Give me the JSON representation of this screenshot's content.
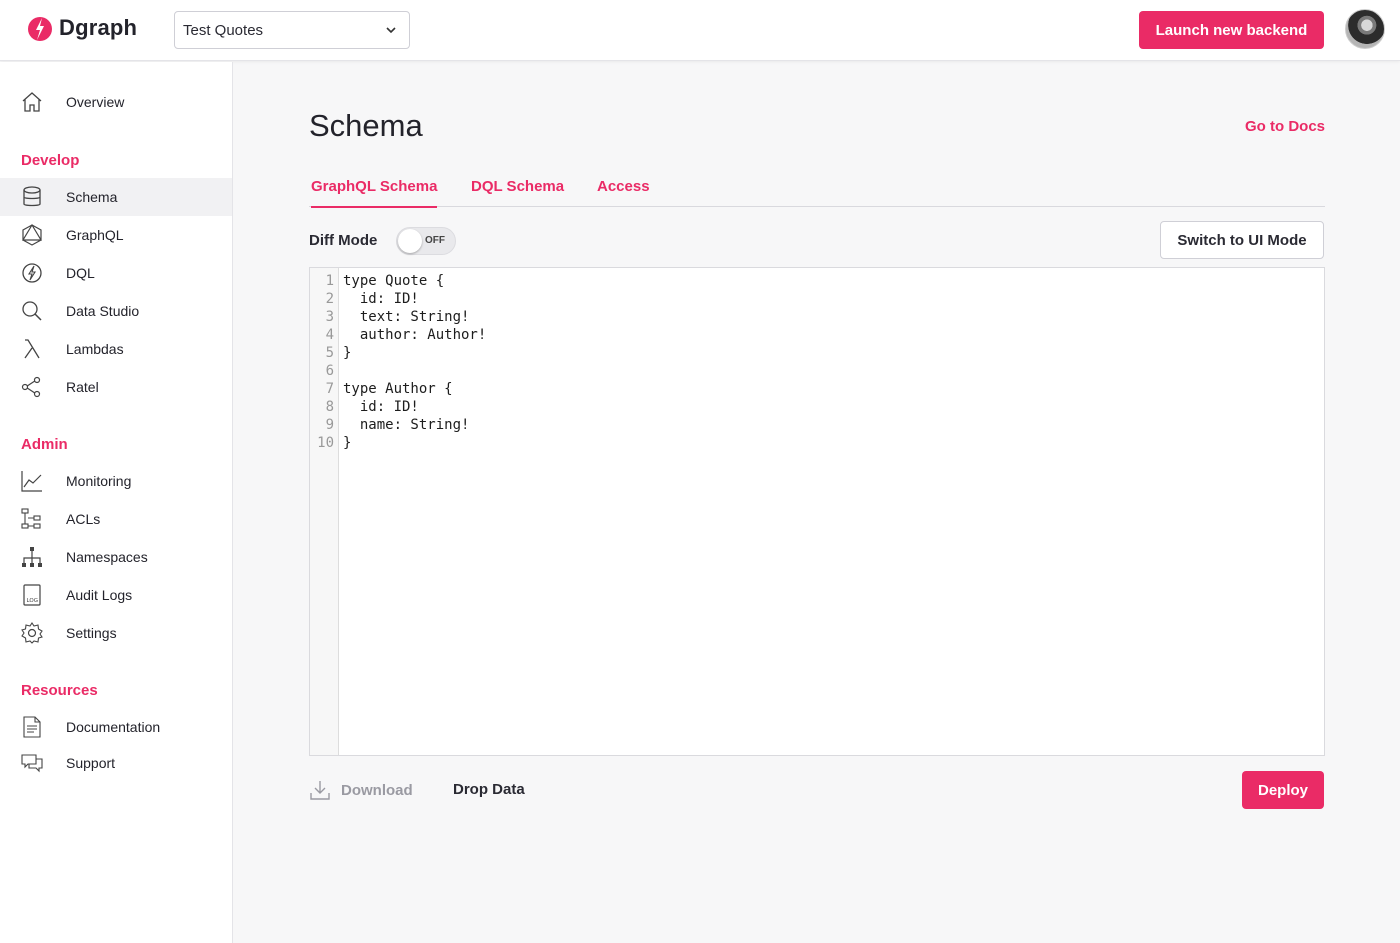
{
  "brand": {
    "name": "Dgraph",
    "accent": "#ea2b66"
  },
  "header": {
    "backend_selected": "Test Quotes",
    "launch_label": "Launch new backend",
    "avatar_icon": "user-avatar"
  },
  "sidebar": {
    "overview": "Overview",
    "sections": {
      "develop": "Develop",
      "admin": "Admin",
      "resources": "Resources"
    },
    "develop_items": [
      "Schema",
      "GraphQL",
      "DQL",
      "Data Studio",
      "Lambdas",
      "Ratel"
    ],
    "admin_items": [
      "Monitoring",
      "ACLs",
      "Namespaces",
      "Audit Logs",
      "Settings"
    ],
    "resource_items": [
      "Documentation",
      "Support"
    ],
    "active_item": "Schema"
  },
  "main": {
    "title": "Schema",
    "docs_link": "Go to Docs",
    "tabs": [
      "GraphQL Schema",
      "DQL Schema",
      "Access"
    ],
    "active_tab": "GraphQL Schema",
    "diff_mode_label": "Diff Mode",
    "diff_mode_state": "OFF",
    "switch_mode_label": "Switch to UI Mode",
    "editor": {
      "line_numbers": [
        "1",
        "2",
        "3",
        "4",
        "5",
        "6",
        "7",
        "8",
        "9",
        "10"
      ],
      "lines": [
        "type Quote {",
        "  id: ID!",
        "  text: String!",
        "  author: Author!",
        "}",
        "",
        "type Author {",
        "  id: ID!",
        "  name: String!",
        "}"
      ]
    },
    "download_label": "Download",
    "drop_data_label": "Drop Data",
    "deploy_label": "Deploy"
  }
}
